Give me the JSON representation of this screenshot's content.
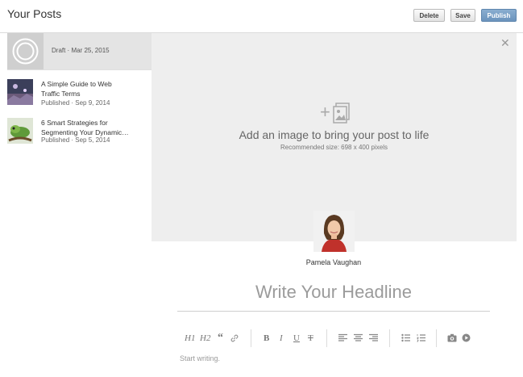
{
  "header": {
    "title": "Your Posts",
    "delete_label": "Delete",
    "save_label": "Save",
    "publish_label": "Publish"
  },
  "sidebar": {
    "draft": {
      "label": "Draft · Mar 25, 2015"
    },
    "posts": [
      {
        "title_line1": "A Simple Guide to Web",
        "title_line2": "Traffic Terms",
        "meta": "Published · Sep 9, 2014"
      },
      {
        "title_line1": "6 Smart Strategies for",
        "title_line2": "Segmenting Your Dynamic…",
        "meta": "Published · Sep 5, 2014"
      }
    ]
  },
  "editor": {
    "image_prompt": "Add an image to bring your post to life",
    "image_hint": "Recommended size: 698 x 400 pixels",
    "author_name": "Pamela Vaughan",
    "headline_placeholder": "Write Your Headline",
    "body_placeholder": "Start writing.",
    "toolbar": {
      "h1": "H1",
      "h2": "H2",
      "quote": "“",
      "bold": "B",
      "italic": "I",
      "underline": "U",
      "strike": "T"
    }
  },
  "colors": {
    "publish": "#7a9fc6",
    "image_area": "#eeeeee",
    "draft_row": "#e4e4e4"
  },
  "icons": {
    "close": "close-icon",
    "add_image": "add-image-icon",
    "camera": "camera-icon",
    "video": "video-icon"
  }
}
